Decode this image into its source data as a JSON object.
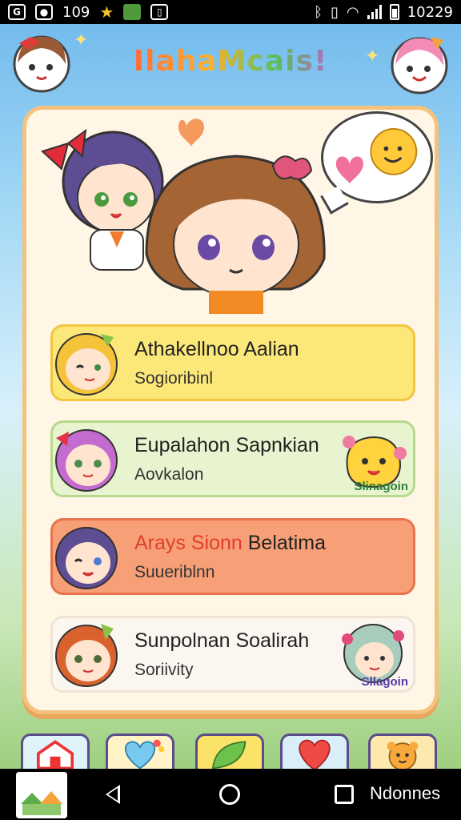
{
  "status_bar": {
    "icons": [
      "g-icon",
      "photo-icon",
      "star-icon",
      "map-icon",
      "screenshot-icon",
      "bluetooth-icon",
      "vibrate-icon",
      "wifi-icon",
      "signal-icon",
      "battery-icon"
    ],
    "left_text": "109",
    "time": "10229"
  },
  "app": {
    "title": "IlahaMcais!"
  },
  "list": [
    {
      "title": "Athakellnoo Aalian",
      "subtitle": "Sogioribinl",
      "color": "#fbe879"
    },
    {
      "title": "Eupalahon Sapnkian",
      "subtitle": "Aovkalon",
      "badge": "Slinagoin",
      "color": "#e8f3cf"
    },
    {
      "title_accent": "Arays Sionn",
      "title_rest": " Belatima",
      "subtitle": "Suueriblnn",
      "color": "#f7a077",
      "accent_color": "#e23d2e"
    },
    {
      "title": "Sunpolnan Soalirah",
      "subtitle": "Soriivity",
      "badge": "Sllagoin",
      "color": "#fbf7f0"
    }
  ],
  "tabs": [
    "home-tab",
    "heart-tab",
    "leaf-tab",
    "favorite-tab",
    "profile-tab"
  ],
  "nav_bar": {
    "label": "Ndonnes"
  },
  "colors": {
    "card_border": "#f5c27d",
    "card_background": "#fff6e6"
  }
}
